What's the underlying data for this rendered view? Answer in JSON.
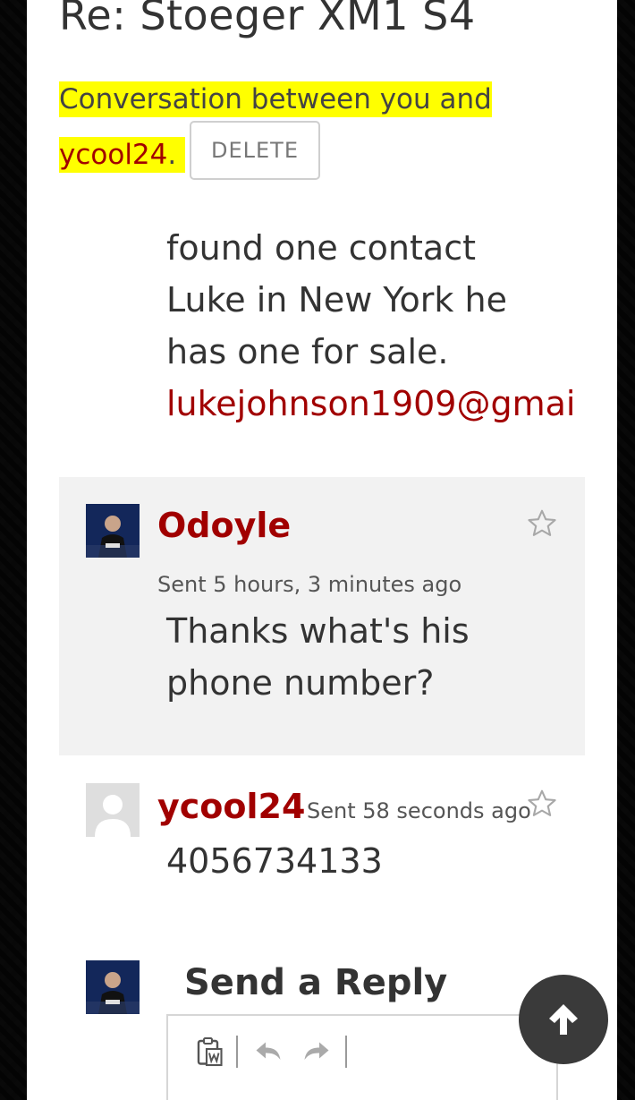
{
  "thread": {
    "title": "Re: Stoeger XM1 S4",
    "conversation_prefix": "Conversation between you and",
    "conversation_user": "ycool24",
    "conversation_suffix": ".",
    "delete_label": "DELETE"
  },
  "partial_message": {
    "lines": [
      "found one contact",
      "Luke in New York he",
      "has one for sale."
    ],
    "email": "lukejohnson1909@gmai"
  },
  "messages": [
    {
      "username": "Odoyle",
      "sent": "Sent 5 hours, 3 minutes ago",
      "body_lines": [
        "Thanks what's his",
        "phone number?"
      ],
      "starred": false
    },
    {
      "username": "ycool24",
      "sent": "Sent 58 seconds ago",
      "body": "4056734133",
      "starred": false
    }
  ],
  "reply": {
    "title": "Send a Reply"
  },
  "icons": {
    "star": "star-outline-icon",
    "paste": "paste-from-word-icon",
    "undo": "undo-icon",
    "redo": "redo-icon",
    "scroll_top": "arrow-up-icon"
  },
  "colors": {
    "link": "#a10000",
    "highlight": "#ffff00",
    "grey_message_bg": "#f2f2f2"
  }
}
